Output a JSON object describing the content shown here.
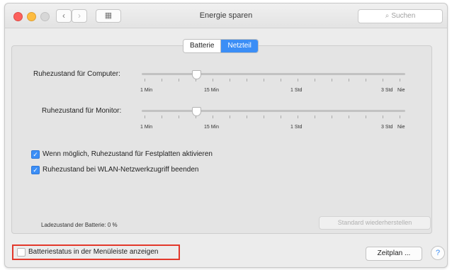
{
  "window": {
    "title": "Energie sparen",
    "search_placeholder": "Suchen",
    "nav_back": "‹",
    "nav_forward": "›",
    "grid_icon": "▦"
  },
  "tabs": [
    {
      "label": "Batterie",
      "selected": false
    },
    {
      "label": "Netzteil",
      "selected": true
    }
  ],
  "sliders": [
    {
      "label": "Ruhezustand für Computer:",
      "scale": [
        "1 Min",
        "15 Min",
        "1 Std",
        "3 Std",
        "Nie"
      ],
      "value": "15 Min"
    },
    {
      "label": "Ruhezustand für Monitor:",
      "scale": [
        "1 Min",
        "15 Min",
        "1 Std",
        "3 Std",
        "Nie"
      ],
      "value": "15 Min"
    }
  ],
  "checkboxes": [
    {
      "label": "Wenn möglich, Ruhezustand für Festplatten aktivieren",
      "checked": true
    },
    {
      "label": "Ruhezustand bei WLAN-Netzwerkzugriff beenden",
      "checked": true
    }
  ],
  "battery_status": "Ladezustand der Batterie: 0 %",
  "restore_button": "Standard wiederherstellen",
  "menu_bar_checkbox": {
    "label": "Batteriestatus in der Menüleiste anzeigen",
    "checked": false
  },
  "schedule_button": "Zeitplan ...",
  "help_button": "?",
  "colors": {
    "accent": "#3b8ef6",
    "highlight_border": "#e2382b"
  }
}
